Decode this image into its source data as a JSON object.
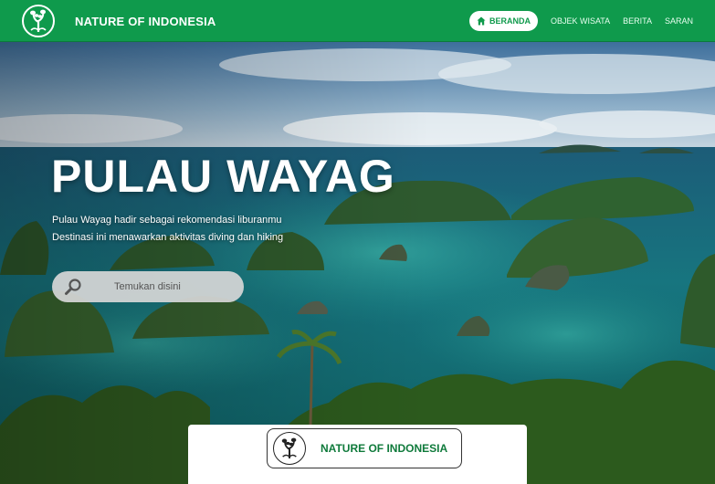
{
  "brand": {
    "name": "NATURE OF INDONESIA",
    "logo_icon": "tree-hand-icon"
  },
  "nav": {
    "items": [
      {
        "label": "BERANDA",
        "icon": "home-icon",
        "active": true
      },
      {
        "label": "OBJEK WISATA",
        "active": false
      },
      {
        "label": "BERITA",
        "active": false
      },
      {
        "label": "SARAN",
        "active": false
      }
    ]
  },
  "hero": {
    "title": "PULAU WAYAG",
    "desc_line1": "Pulau Wayag hadir sebagai rekomendasi liburanmu",
    "desc_line2": "Destinasi ini menawarkan aktivitas diving dan hiking"
  },
  "search": {
    "placeholder": "Temukan disini",
    "icon": "search-icon"
  },
  "footer_card": {
    "name": "NATURE OF INDONESIA"
  },
  "colors": {
    "primary": "#0f9a4c",
    "text_light": "#ffffff",
    "card_text": "#0f7a3b"
  }
}
